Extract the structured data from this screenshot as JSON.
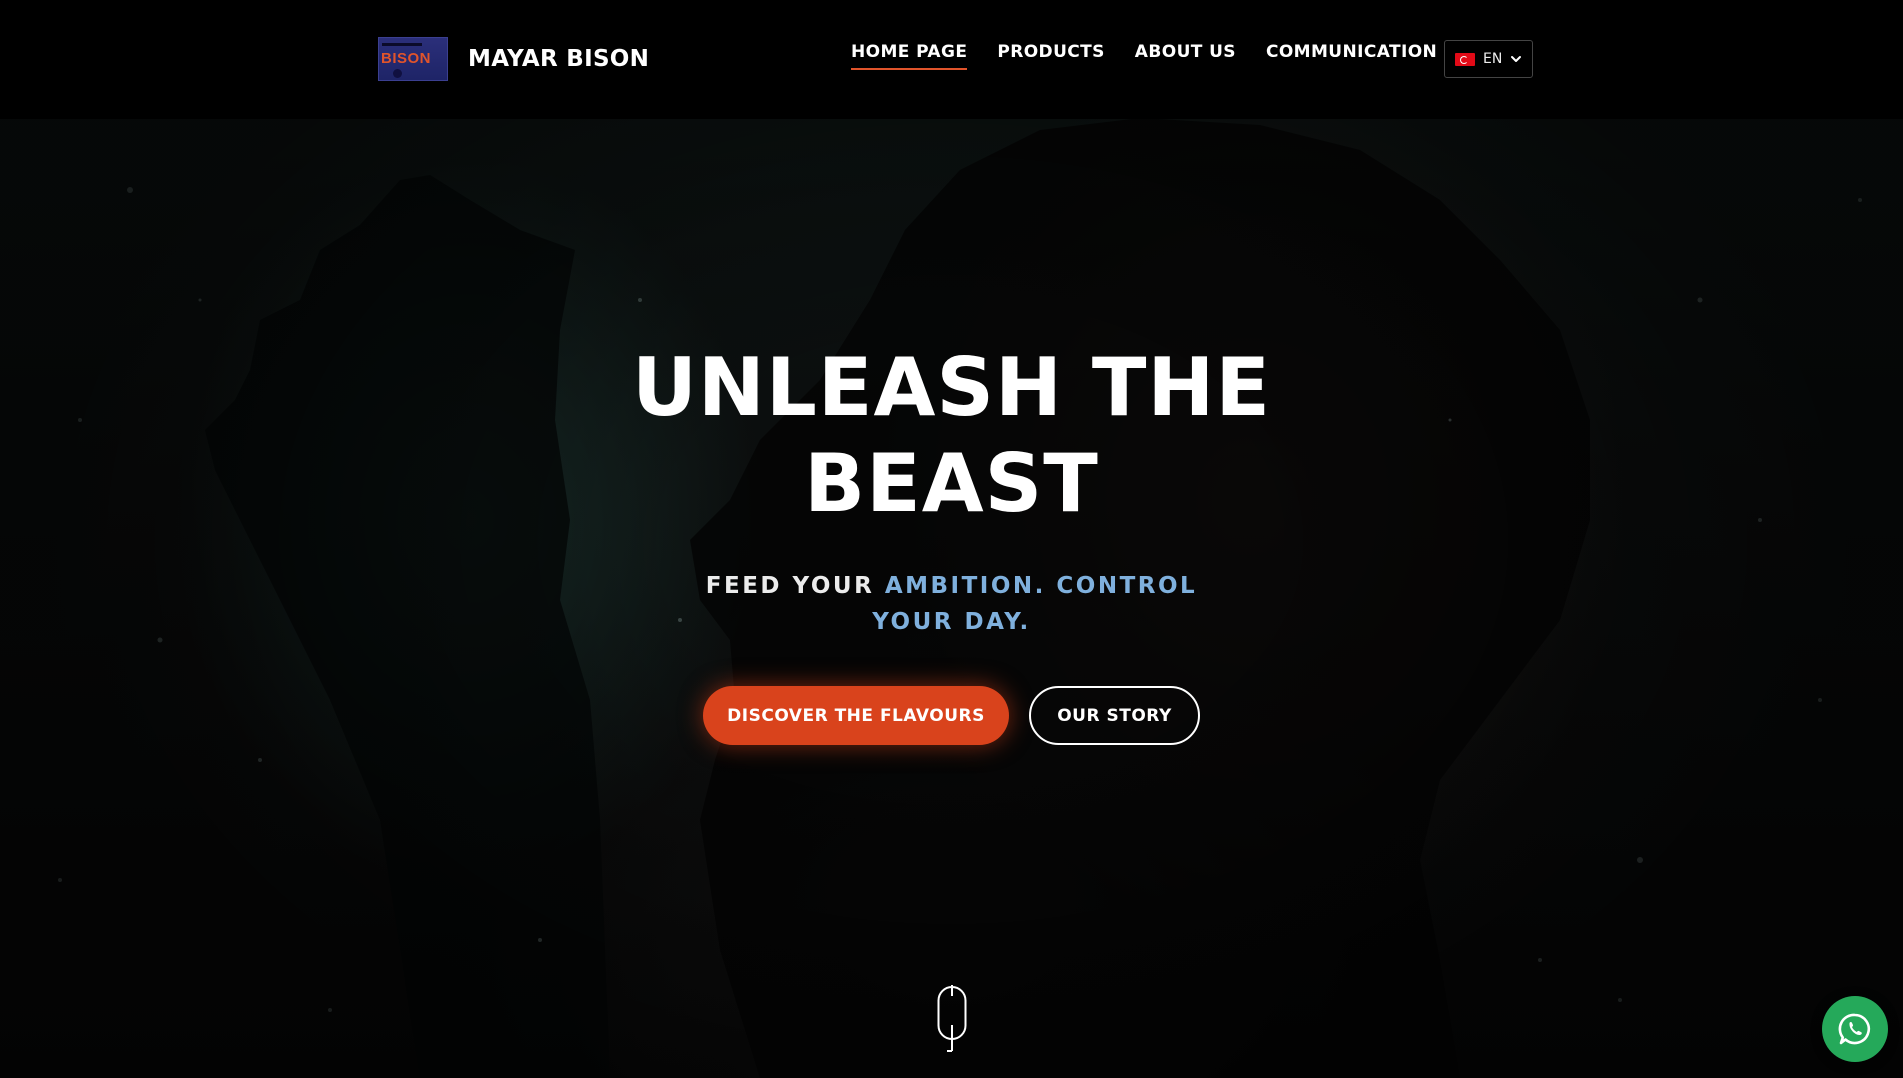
{
  "header": {
    "brand_name": "MAYAR BISON",
    "logo_text": "BISON",
    "nav": [
      {
        "label": "HOME PAGE",
        "active": true
      },
      {
        "label": "PRODUCTS",
        "active": false
      },
      {
        "label": "ABOUT US",
        "active": false
      },
      {
        "label": "COMMUNICATION",
        "active": false
      }
    ],
    "language": {
      "code": "EN",
      "flag": "turkey-flag-icon"
    }
  },
  "hero": {
    "title_line1": "UNLEASH THE",
    "title_line2": "BEAST",
    "subtitle": {
      "part1": "FEED YOUR",
      "part2": "AMBITION.",
      "part3": "CONTROL YOUR",
      "part4": "DAY."
    },
    "primary_cta": "DISCOVER THE FLAVOURS",
    "secondary_cta": "OUR STORY"
  },
  "floating": {
    "whatsapp": "whatsapp-icon"
  },
  "colors": {
    "accent": "#d9431c",
    "subtitle_blue": "#7fb0dd",
    "header_bg": "#000000",
    "whatsapp": "#25a95a"
  }
}
